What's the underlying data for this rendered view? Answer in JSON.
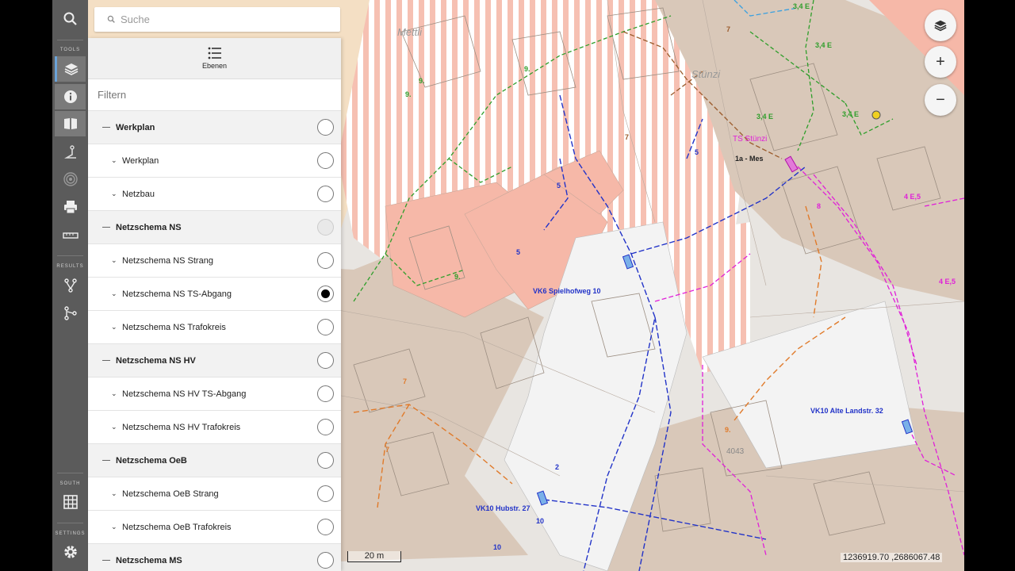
{
  "search": {
    "placeholder": "Suche"
  },
  "toolbar": {
    "labels": {
      "tools": "TOOLS",
      "results": "RESULTS",
      "south": "SOUTH",
      "settings": "SETTINGS"
    },
    "icons": [
      "search-icon",
      "layers-icon",
      "info-icon",
      "book-icon",
      "measure-icon",
      "target-icon",
      "print-icon",
      "ruler-icon",
      "branch-icon",
      "route-icon",
      "grid-icon",
      "gear-icon"
    ]
  },
  "panel": {
    "header_label": "Ebenen",
    "filter_placeholder": "Filtern",
    "rows": [
      {
        "label": "Werkplan",
        "type": "group",
        "state": "off"
      },
      {
        "label": "Werkplan",
        "type": "item",
        "state": "off"
      },
      {
        "label": "Netzbau",
        "type": "item",
        "state": "off"
      },
      {
        "label": "Netzschema NS",
        "type": "group",
        "state": "disabled"
      },
      {
        "label": "Netzschema NS Strang",
        "type": "item",
        "state": "off"
      },
      {
        "label": "Netzschema NS TS-Abgang",
        "type": "item",
        "state": "on"
      },
      {
        "label": "Netzschema NS Trafokreis",
        "type": "item",
        "state": "off"
      },
      {
        "label": "Netzschema NS HV",
        "type": "group",
        "state": "off"
      },
      {
        "label": "Netzschema NS HV TS-Abgang",
        "type": "item",
        "state": "off"
      },
      {
        "label": "Netzschema NS HV Trafokreis",
        "type": "item",
        "state": "off"
      },
      {
        "label": "Netzschema OeB",
        "type": "group",
        "state": "off"
      },
      {
        "label": "Netzschema OeB Strang",
        "type": "item",
        "state": "off"
      },
      {
        "label": "Netzschema OeB Trafokreis",
        "type": "item",
        "state": "off"
      },
      {
        "label": "Netzschema MS",
        "type": "group",
        "state": "off"
      }
    ]
  },
  "map": {
    "place_labels": [
      "Mettli",
      "Stünzi"
    ],
    "station_labels": [
      "TS Stünzi",
      "1a - Mes",
      "VK6 Spielhofweg 10",
      "VK10 Alte Landstr. 32",
      "VK10 Hubstr. 27"
    ],
    "parcel_numbers": [
      "4043"
    ],
    "segment_labels": [
      "3,4 E",
      "3,4 E",
      "3,4 E",
      "3,4 E",
      "4 E,5",
      "4 E,5",
      "9.",
      "9.",
      "9.",
      "9.",
      "7",
      "7",
      "7",
      "7",
      "5",
      "5",
      "5",
      "8",
      "2",
      "10",
      "10",
      "9."
    ],
    "scale_label": "20 m",
    "coordinates": "1236919.70 ,2686067.48",
    "colors": {
      "parcel_salmon": "#f6b8a8",
      "parcel_tan": "#d8c7b8",
      "parcel_beige": "#f4dfc4",
      "parcel_white": "#f3f3f3",
      "network_green": "#2e9e2a",
      "network_blue": "#2233c8",
      "network_magenta": "#e020d8",
      "network_orange": "#e07a2a",
      "network_brown": "#9a5a2a",
      "network_cyan": "#3aa0e0"
    }
  },
  "controls": {
    "zoom_in": "+",
    "zoom_out": "−"
  }
}
